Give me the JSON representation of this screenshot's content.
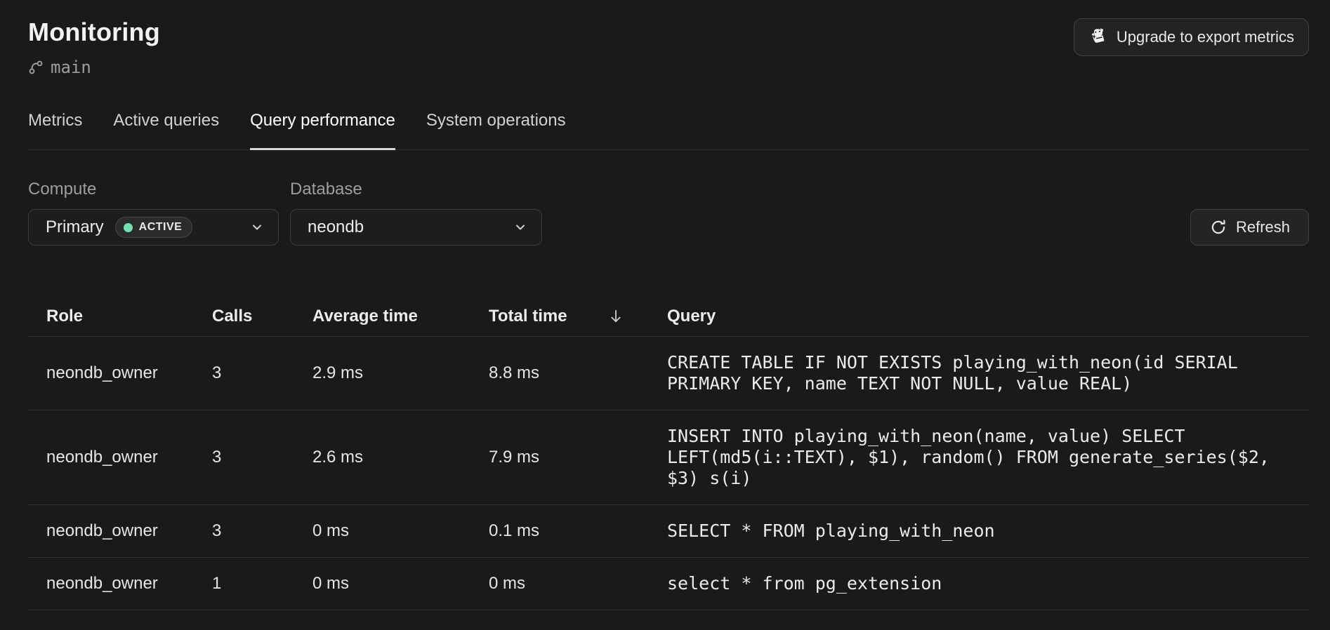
{
  "page": {
    "title": "Monitoring",
    "branch": "main"
  },
  "header": {
    "upgrade_button_label": "Upgrade to export metrics"
  },
  "tabs": [
    {
      "label": "Metrics",
      "active": false
    },
    {
      "label": "Active queries",
      "active": false
    },
    {
      "label": "Query performance",
      "active": true
    },
    {
      "label": "System operations",
      "active": false
    }
  ],
  "filters": {
    "compute": {
      "label": "Compute",
      "value": "Primary",
      "status": "ACTIVE"
    },
    "database": {
      "label": "Database",
      "value": "neondb"
    },
    "refresh_label": "Refresh"
  },
  "table": {
    "columns": [
      "Role",
      "Calls",
      "Average time",
      "Total time",
      "Query"
    ],
    "sort": {
      "column": "Total time",
      "direction": "desc"
    },
    "rows": [
      {
        "role": "neondb_owner",
        "calls": "3",
        "average_time": "2.9 ms",
        "total_time": "8.8 ms",
        "query": "CREATE TABLE IF NOT EXISTS playing_with_neon(id SERIAL PRIMARY KEY, name TEXT NOT NULL, value REAL)"
      },
      {
        "role": "neondb_owner",
        "calls": "3",
        "average_time": "2.6 ms",
        "total_time": "7.9 ms",
        "query": "INSERT INTO playing_with_neon(name, value) SELECT LEFT(md5(i::TEXT), $1), random() FROM generate_series($2, $3) s(i)"
      },
      {
        "role": "neondb_owner",
        "calls": "3",
        "average_time": "0 ms",
        "total_time": "0.1 ms",
        "query": "SELECT * FROM playing_with_neon"
      },
      {
        "role": "neondb_owner",
        "calls": "1",
        "average_time": "0 ms",
        "total_time": "0 ms",
        "query": "select * from pg_extension"
      }
    ]
  },
  "icons": {
    "upgrade": "datadog-icon",
    "branch": "branch-icon",
    "selects": "chevron-down-icon",
    "refresh": "refresh-icon",
    "sort": "arrow-down-icon"
  },
  "colors": {
    "background": "#1a1a1a",
    "control_background": "#242424",
    "border": "#3d3d3d",
    "row_divider": "#303030",
    "text_primary": "#ececec",
    "text_muted": "#9e9e9e",
    "active_dot_green": "#6fe3ad",
    "tab_underline": "#d6d6d6"
  }
}
